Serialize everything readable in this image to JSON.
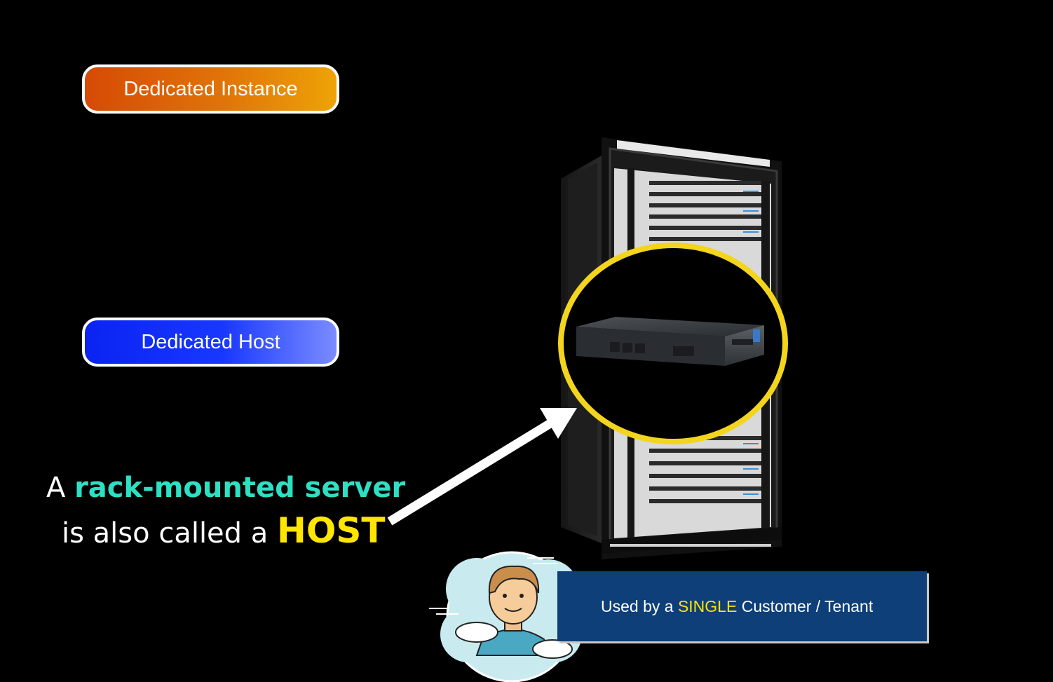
{
  "buttons": {
    "dedicated_instance": "Dedicated Instance",
    "dedicated_host": "Dedicated Host"
  },
  "caption": {
    "line1_prefix": "A ",
    "line1_highlight": "rack-mounted server",
    "line2_prefix": "is also called a ",
    "line2_highlight": "HOST"
  },
  "banner": {
    "prefix": "Used by a ",
    "highlight": "SINGLE",
    "suffix": " Customer / Tenant"
  },
  "colors": {
    "background": "#000000",
    "instance_gradient": [
      "#d64a06",
      "#eea307"
    ],
    "host_gradient": [
      "#0a23f2",
      "#7b8cff"
    ],
    "caption_highlight": "#2de0c4",
    "host_highlight": "#ffe600",
    "focus_circle": "#f2d51c",
    "banner_background": "#0e3f78"
  },
  "icons": {
    "rack": "server-rack-icon",
    "server": "rack-server-unit-icon",
    "arrow": "pointer-arrow-icon",
    "avatar": "customer-avatar-icon"
  }
}
